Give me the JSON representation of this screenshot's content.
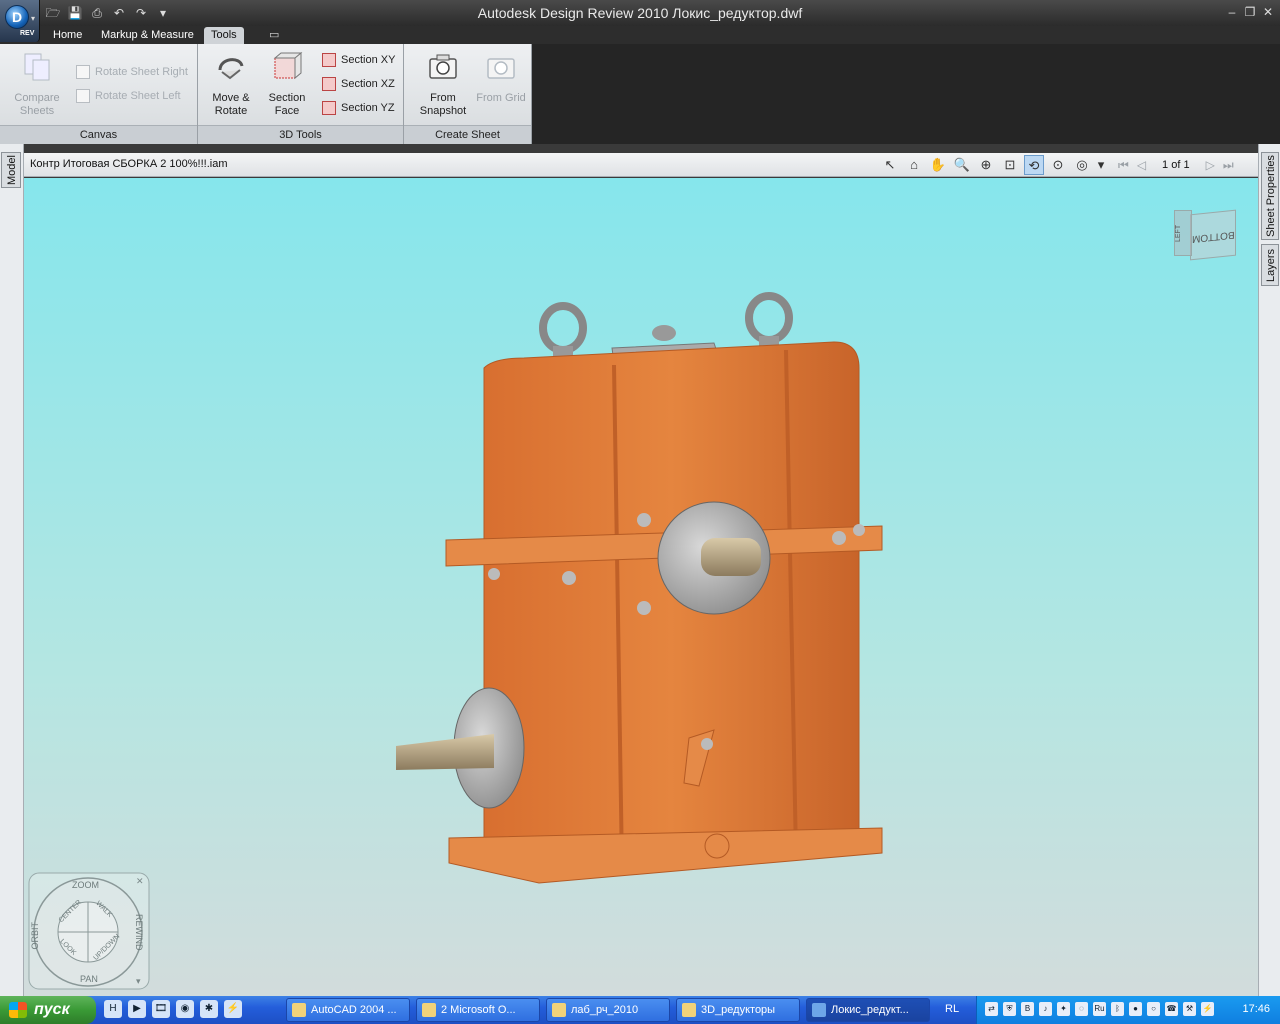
{
  "window": {
    "title": "Autodesk Design Review 2010    Локис_редуктор.dwf",
    "app_badge": "REV"
  },
  "tabs": [
    {
      "label": "Home"
    },
    {
      "label": "Markup & Measure"
    },
    {
      "label": "Tools",
      "active": true
    }
  ],
  "ribbon": {
    "canvas": {
      "title": "Canvas",
      "compare_sheets": "Compare Sheets",
      "rotate_right": "Rotate Sheet Right",
      "rotate_left": "Rotate Sheet Left"
    },
    "tools3d": {
      "title": "3D Tools",
      "move_rotate": "Move & Rotate",
      "section_face": "Section Face",
      "section_xy": "Section XY",
      "section_xz": "Section XZ",
      "section_yz": "Section YZ"
    },
    "create_sheet": {
      "title": "Create Sheet",
      "from_snapshot": "From Snapshot",
      "from_grid": "From Grid"
    }
  },
  "side_tabs": {
    "left": "Model",
    "right_1": "Sheet Properties",
    "right_2": "Layers"
  },
  "document": {
    "name": "Контр Итоговая СБОРКА 2 100%!!!.iam",
    "page_indicator": "1 of 1"
  },
  "viewcube": {
    "face_main": "BOTTOM",
    "face_side": "LEFT"
  },
  "steering_wheel": {
    "zoom": "ZOOM",
    "orbit": "ORBIT",
    "pan": "PAN",
    "rewind": "REWIND",
    "center": "CENTER",
    "walk": "WALK",
    "look": "LOOK",
    "updown": "UP/DOWN"
  },
  "taskbar": {
    "start": "пуск",
    "tasks": [
      {
        "label": "AutoCAD 2004 ..."
      },
      {
        "label": "2 Microsoft O..."
      },
      {
        "label": "лаб_рч_2010"
      },
      {
        "label": "3D_редукторы"
      },
      {
        "label": "Локис_редукт...",
        "active": true
      }
    ],
    "lang": "RL",
    "clock": "17:46"
  },
  "colors": {
    "housing": "#e07a3a",
    "viewport_top": "#86e6ec",
    "viewport_bottom": "#d2dcdc"
  }
}
